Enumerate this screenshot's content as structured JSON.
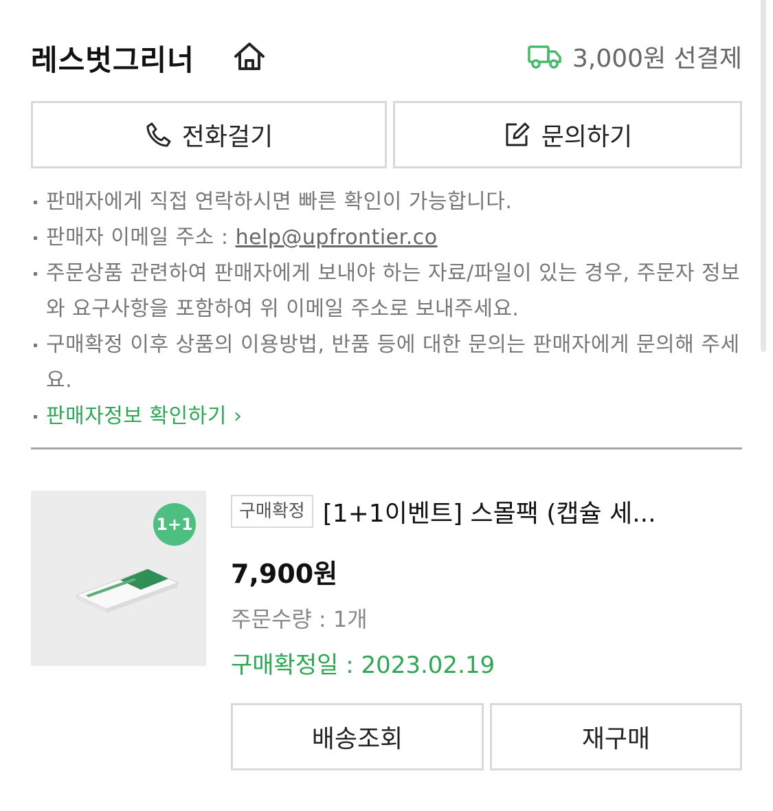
{
  "store": {
    "name": "레스벗그리너",
    "home_icon": "home-icon",
    "shipping_icon": "truck-icon",
    "shipping_text": "3,000원 선결제"
  },
  "actions": {
    "call_label": "전화걸기",
    "call_icon": "phone-icon",
    "inquiry_label": "문의하기",
    "inquiry_icon": "edit-icon"
  },
  "notices": {
    "line1": "판매자에게 직접 연락하시면 빠른 확인이 가능합니다.",
    "email_prefix": "판매자 이메일 주소 : ",
    "email": "help@upfrontier.co",
    "line3": "주문상품 관련하여 판매자에게 보내야 하는 자료/파일이 있는 경우, 주문자 정보와 요구사항을 포함하여 위 이메일 주소로 보내주세요.",
    "line4": "구매확정 이후 상품의 이용방법, 반품 등에 대한 문의는 판매자에게 문의해 주세요.",
    "seller_info_link": "판매자정보 확인하기"
  },
  "product": {
    "thumbnail_badge": "1+1",
    "status_tag": "구매확정",
    "title": "[1+1이벤트] 스몰팩 (캡슐 세...",
    "price": "7,900원",
    "quantity": "주문수량 : 1개",
    "confirmed_date": "구매확정일 : 2023.02.19"
  },
  "bottom_actions": {
    "track_label": "배송조회",
    "rebuy_label": "재구매"
  },
  "colors": {
    "accent_green": "#2aa952",
    "border": "#d9d9d9",
    "badge_green": "#4dbf80"
  }
}
